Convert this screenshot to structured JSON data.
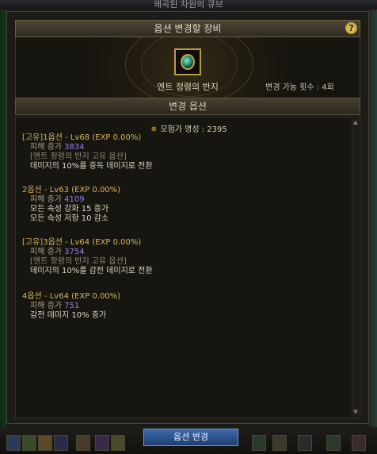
{
  "window": {
    "title": "왜곡된 차원의 큐브"
  },
  "header": {
    "title": "옵션 변경할 장비",
    "help": "?"
  },
  "item": {
    "name": "엔트 정령의 반지",
    "change_count": "변경 가능 횟수 : 4회"
  },
  "section": {
    "title": "변경 옵션"
  },
  "fame": {
    "label": "모험가 명성 : 2395"
  },
  "options": [
    {
      "title": "[고유]1옵션 - Lv68 (EXP 0.00%)",
      "damage_label": "피해 증가",
      "damage_value": "3834",
      "unique_note": "[엔트 정령의 반지 고유 옵션]",
      "effects": [
        "데미지의 10%를 중독 데미지로 전환"
      ]
    },
    {
      "title": "2옵션 - Lv63 (EXP 0.00%)",
      "damage_label": "피해 증가",
      "damage_value": "4109",
      "unique_note": "",
      "effects": [
        "모든 속성 강화 15 증가",
        "모든 속성 저항 10 감소"
      ]
    },
    {
      "title": "[고유]3옵션 - Lv64 (EXP 0.00%)",
      "damage_label": "피해 증가",
      "damage_value": "3754",
      "unique_note": "[엔트 정령의 반지 고유 옵션]",
      "effects": [
        "데미지의 10%를 감전 데미지로 전환"
      ]
    },
    {
      "title": "4옵션 - Lv64 (EXP 0.00%)",
      "damage_label": "피해 증가",
      "damage_value": "751",
      "unique_note": "",
      "effects": [
        "감전 데미지 10% 증가"
      ]
    }
  ],
  "footer": {
    "change_button": "옵션 변경"
  },
  "colors": {
    "accent_gold": "#d8b45c",
    "damage_purple": "#9a7cf0",
    "button_blue": "#2d558e"
  }
}
